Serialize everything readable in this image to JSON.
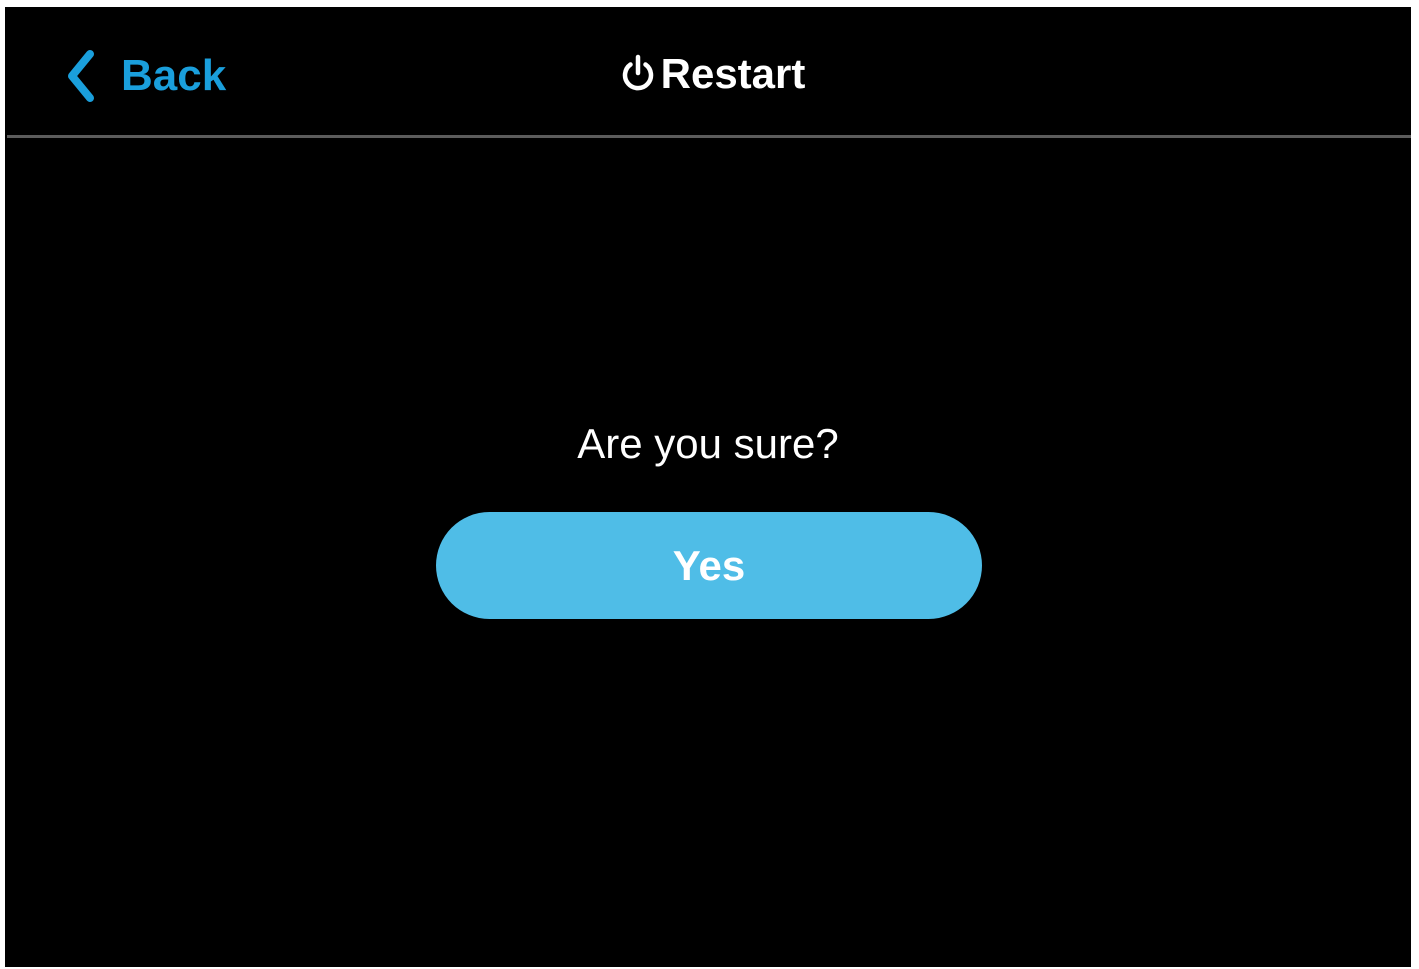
{
  "colors": {
    "background": "#000000",
    "accent": "#4fbde7",
    "accent_text": "#1a9fdc",
    "text": "#ffffff",
    "divider": "#5c5c5c"
  },
  "header": {
    "back_icon": "chevron-left-icon",
    "back_label": "Back",
    "title_icon": "power-icon",
    "title": "Restart"
  },
  "dialog": {
    "prompt": "Are you sure?",
    "confirm_label": "Yes"
  }
}
